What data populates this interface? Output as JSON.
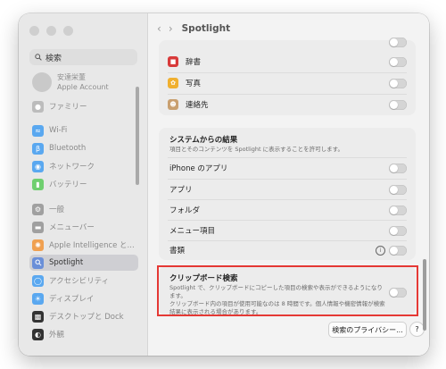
{
  "sidebar": {
    "search_placeholder": "検索",
    "account": {
      "name": "安達栄董",
      "subtitle": "Apple Account"
    },
    "family": "ファミリー",
    "items": [
      {
        "label": "Wi-Fi",
        "icon": "wifi-icon",
        "color": "#5aa8f0"
      },
      {
        "label": "Bluetooth",
        "icon": "bluetooth-icon",
        "color": "#5aa8f0"
      },
      {
        "label": "ネットワーク",
        "icon": "globe-icon",
        "color": "#5aa8f0"
      },
      {
        "label": "バッテリー",
        "icon": "battery-icon",
        "color": "#6fcf6f"
      },
      {
        "label": "一般",
        "icon": "gear-icon",
        "color": "#a0a0a0"
      },
      {
        "label": "メニューバー",
        "icon": "menubar-icon",
        "color": "#a0a0a0"
      },
      {
        "label": "Apple Intelligence と...",
        "icon": "apple-intelligence-icon",
        "color": "#f0a050"
      },
      {
        "label": "Spotlight",
        "icon": "spotlight-icon",
        "color": "#6a8fd8"
      },
      {
        "label": "アクセシビリティ",
        "icon": "accessibility-icon",
        "color": "#5aa8f0"
      },
      {
        "label": "ディスプレイ",
        "icon": "display-icon",
        "color": "#5aa8f0"
      },
      {
        "label": "デスクトップと Dock",
        "icon": "dock-icon",
        "color": "#333333"
      },
      {
        "label": "外観",
        "icon": "appearance-icon",
        "color": "#333333"
      }
    ]
  },
  "main": {
    "title": "Spotlight",
    "top_rows": [
      {
        "label": "辞書",
        "icon": "dictionary-icon",
        "color": "#d83a3a"
      },
      {
        "label": "写真",
        "icon": "photos-icon",
        "color": "#f0b030"
      },
      {
        "label": "連絡先",
        "icon": "contacts-icon",
        "color": "#c9a070"
      }
    ],
    "system_results": {
      "heading": "システムからの結果",
      "description": "項目とそのコンテンツを Spotlight に表示することを許可します。",
      "rows": [
        "iPhone のアプリ",
        "アプリ",
        "フォルダ",
        "メニュー項目",
        "書類"
      ]
    },
    "clipboard": {
      "heading": "クリップボード検索",
      "description_1": "Spotlight で、クリップボードにコピーした項目の検索や表示ができるようになります。",
      "description_2": "クリップボード内の項目が使用可能なのは 8 時間です。個人情報や機密情報が検索",
      "description_3": "結果に表示される場合があります。"
    },
    "privacy_button": "検索のプライバシー...",
    "help_button": "?"
  }
}
